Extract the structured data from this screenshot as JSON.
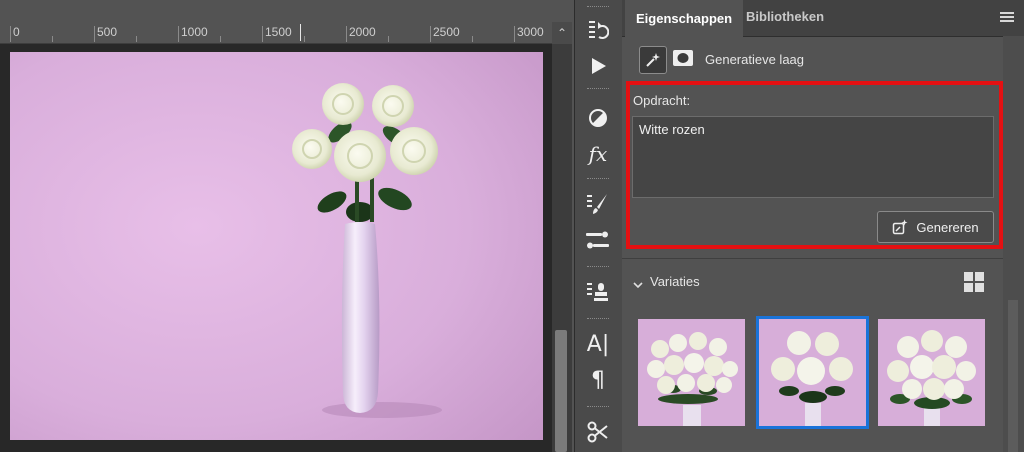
{
  "ruler": {
    "labels": [
      "0",
      "500",
      "1000",
      "1500",
      "2000",
      "2500",
      "3000"
    ],
    "scroll_up_icon": "chevron-up-icon"
  },
  "document": {
    "background_color": "#d9aedb",
    "subject": "vase-with-white-roses-icon"
  },
  "toolbar": {
    "tools": [
      "history-icon",
      "play-icon",
      "adjustment-icon",
      "fx-icon",
      "brush-presets-icon",
      "clone-source-icon",
      "stamp-presets-icon",
      "character-icon",
      "paragraph-icon",
      "tools-icon"
    ],
    "fx_label": "fx",
    "character_label": "A|",
    "paragraph_label": "¶"
  },
  "panel": {
    "tabs": [
      {
        "label": "Eigenschappen",
        "active": true
      },
      {
        "label": "Bibliotheken",
        "active": false
      }
    ],
    "menu_icon": "hamburger-menu-icon",
    "layer": {
      "type_icon": "generative-fill-icon",
      "mask_icon": "mask-icon",
      "label": "Generatieve laag"
    },
    "prompt": {
      "label": "Opdracht:",
      "value": "Witte rozen",
      "highlight_color": "#e41012"
    },
    "generate_button": {
      "label": "Genereren",
      "icon": "generate-sparkle-icon"
    },
    "variations": {
      "label": "Variaties",
      "expanded": true,
      "view_icon": "grid-view-icon",
      "selected_index": 1,
      "selected_color": "#1a73d9",
      "thumbnails": [
        "variation-1-thumbnail",
        "variation-2-thumbnail",
        "variation-3-thumbnail"
      ]
    }
  }
}
